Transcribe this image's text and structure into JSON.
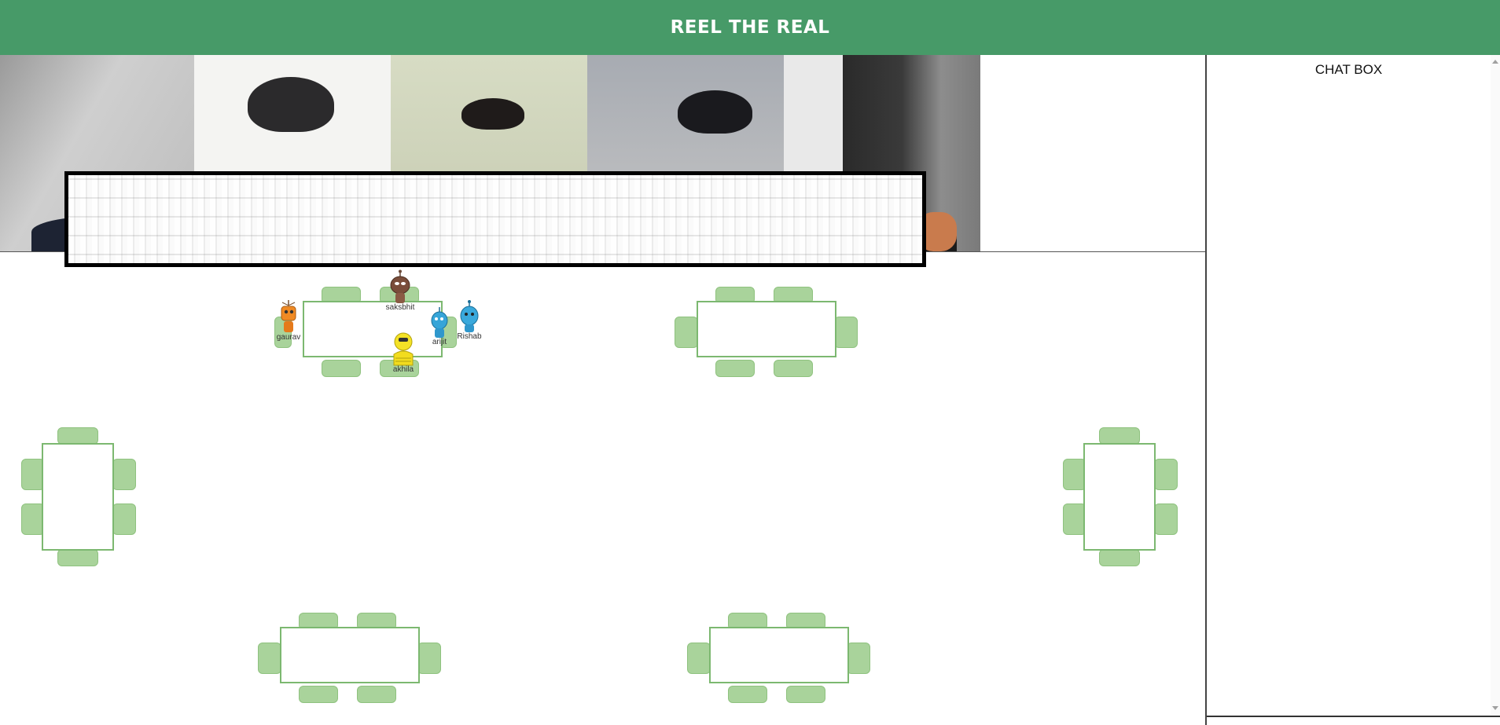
{
  "header": {
    "title": "REEL THE REAL"
  },
  "chat": {
    "title": "CHAT BOX"
  },
  "participants": [
    {
      "name": "saksbhit"
    },
    {
      "name": "gaurav"
    },
    {
      "name": "arijit"
    },
    {
      "name": "Rishab"
    },
    {
      "name": "akhila"
    }
  ],
  "colors": {
    "header_bg": "#479a68",
    "chair": "#a9d39b",
    "table_border": "#7cb870"
  }
}
